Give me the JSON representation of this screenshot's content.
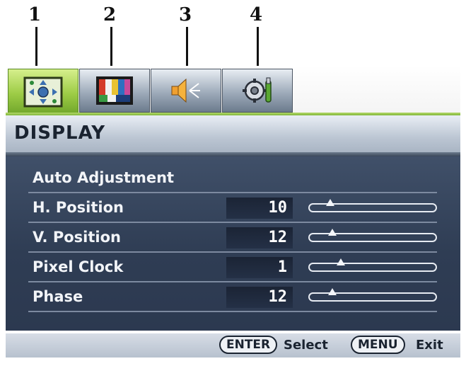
{
  "callouts": [
    "1",
    "2",
    "3",
    "4"
  ],
  "tabs": [
    {
      "name": "picture-adjust-icon",
      "active": true
    },
    {
      "name": "color-bars-icon",
      "active": false
    },
    {
      "name": "speaker-icon",
      "active": false
    },
    {
      "name": "settings-wrench-icon",
      "active": false
    }
  ],
  "header": {
    "title": "DISPLAY"
  },
  "menu": {
    "items": [
      {
        "label": "Auto Adjustment"
      },
      {
        "label": "H. Position",
        "value": "10",
        "level": 10
      },
      {
        "label": "V. Position",
        "value": "12",
        "level": 12
      },
      {
        "label": "Pixel Clock",
        "value": "1",
        "level": 1
      },
      {
        "label": "Phase",
        "value": "12",
        "level": 12
      }
    ]
  },
  "footer": {
    "enter_key": "ENTER",
    "enter_action": "Select",
    "menu_key": "MENU",
    "menu_action": "Exit"
  },
  "colors": {
    "active_tab": "#9ccb45",
    "body_bg": "#2f3d54",
    "title_bg": "#bcc6d3"
  }
}
